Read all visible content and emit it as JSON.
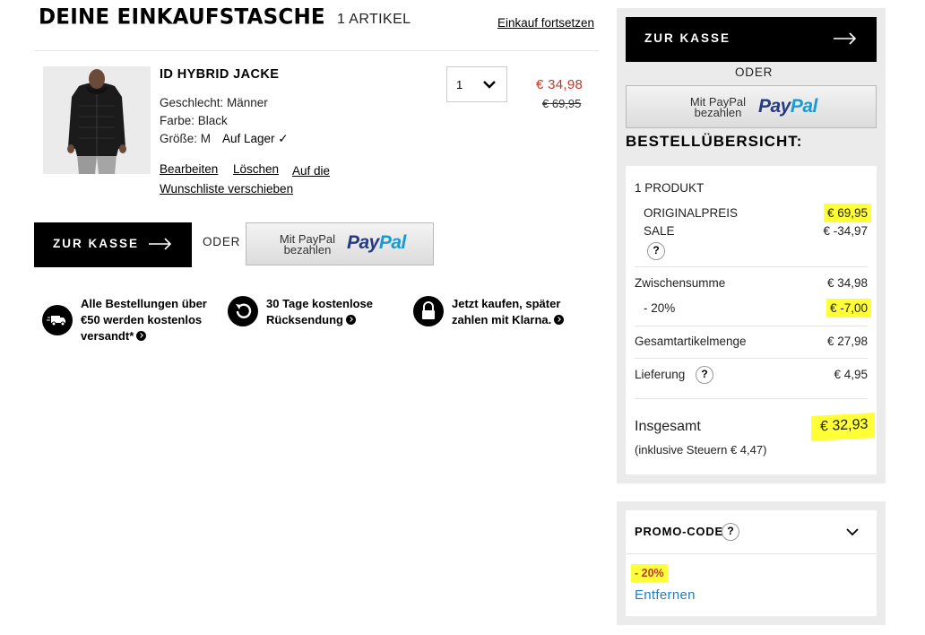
{
  "header": {
    "title": "DEINE EINKAUFSTASCHE",
    "item_count": "1 ARTIKEL",
    "continue_link": "Einkauf fortsetzen"
  },
  "product": {
    "name": "ID HYBRID JACKE",
    "gender": "Geschlecht: Männer",
    "color": "Farbe: Black",
    "size": "Größe: M",
    "stock": "Auf Lager ✓",
    "quantity": "1",
    "price_current": "€ 34,98",
    "price_original": "€ 69,95",
    "actions": {
      "edit": "Bearbeiten",
      "delete": "Löschen",
      "wishlist": "Auf die Wunschliste verschieben"
    }
  },
  "checkout": {
    "label": "ZUR KASSE",
    "or": "ODER",
    "paypal_small": "Mit PayPal bezahlen",
    "paypal_logo_a": "Pay",
    "paypal_logo_b": "Pal"
  },
  "benefits": [
    {
      "icon": "delivery-truck-icon",
      "text": "Alle Bestellungen über €50 werden kostenlos versandt*"
    },
    {
      "icon": "return-arrow-icon",
      "text": "30 Tage kostenlose Rücksendung"
    },
    {
      "icon": "lock-icon",
      "text": "Jetzt kaufen, später zahlen mit Klarna."
    }
  ],
  "summary": {
    "title": "BESTELLÜBERSICHT:",
    "product_count": "1 PRODUKT",
    "original_label": "ORIGINALPREIS",
    "original_value": "€ 69,95",
    "sale_label": "SALE",
    "sale_value": "€ -34,97",
    "help": "?",
    "subtotal_label": "Zwischensumme",
    "subtotal_value": "€ 34,98",
    "discount_label": "- 20%",
    "discount_value": "€ -7,00",
    "article_total_label": "Gesamtartikelmenge",
    "article_total_value": "€ 27,98",
    "delivery_label": "Lieferung",
    "delivery_value": "€ 4,95",
    "total_label": "Insgesamt",
    "total_value": "€ 32,93",
    "tax_note": "(inklusive Steuern  € 4,47)"
  },
  "promo": {
    "title": "PROMO-CODE",
    "code": "- 20%",
    "remove": "Entfernen"
  },
  "colors": {
    "price_red": "#c0392b",
    "highlight": "#ffff38",
    "paypal_dark": "#253b80",
    "paypal_light": "#179bd7",
    "link_blue": "#1f7ec2"
  }
}
